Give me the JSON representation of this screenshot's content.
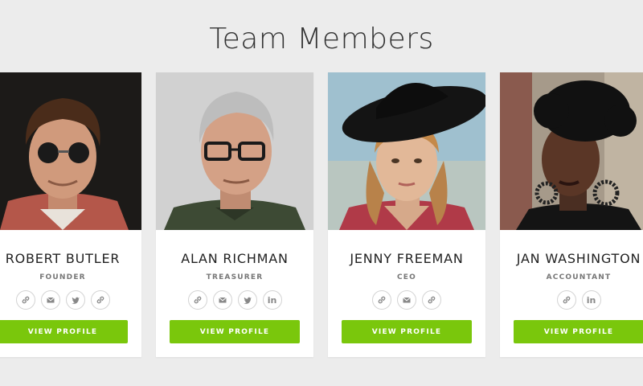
{
  "page": {
    "title": "Team Members"
  },
  "colors": {
    "button": "#7ac70c",
    "background": "#ececec"
  },
  "members": [
    {
      "name": "ROBERT BUTLER",
      "role": "FOUNDER",
      "button_label": "VIEW PROFILE",
      "socials": [
        "link-icon",
        "email-icon",
        "twitter-icon",
        "link-icon"
      ]
    },
    {
      "name": "ALAN RICHMAN",
      "role": "TREASURER",
      "button_label": "VIEW PROFILE",
      "socials": [
        "link-icon",
        "email-icon",
        "twitter-icon",
        "linkedin-icon"
      ],
      "linkedin_text": "in"
    },
    {
      "name": "JENNY FREEMAN",
      "role": "CEO",
      "button_label": "VIEW PROFILE",
      "socials": [
        "link-icon",
        "email-icon",
        "link-icon"
      ]
    },
    {
      "name": "JAN WASHINGTON",
      "role": "ACCOUNTANT",
      "button_label": "VIEW PROFILE",
      "socials": [
        "link-icon",
        "linkedin-icon"
      ],
      "linkedin_text": "in"
    }
  ]
}
